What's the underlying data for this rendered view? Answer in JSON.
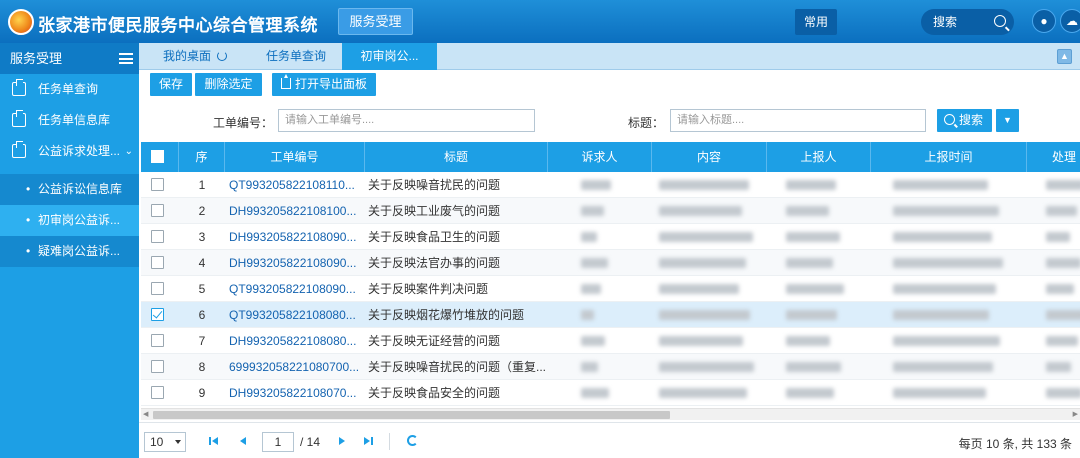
{
  "header": {
    "app_title": "张家港市便民服务中心综合管理系统",
    "top_tab": "服务受理",
    "fav_label": "常用",
    "search_placeholder": "搜索"
  },
  "sidebar": {
    "title": "服务受理",
    "items": [
      {
        "label": "任务单查询"
      },
      {
        "label": "任务单信息库"
      },
      {
        "label": "公益诉求处理..."
      }
    ],
    "subitems": [
      {
        "label": "公益诉讼信息库"
      },
      {
        "label": "初审岗公益诉..."
      },
      {
        "label": "疑难岗公益诉..."
      }
    ]
  },
  "tabs": [
    {
      "label": "我的桌面"
    },
    {
      "label": "任务单查询"
    },
    {
      "label": "初审岗公..."
    }
  ],
  "toolbar": {
    "save": "保存",
    "delete": "删除选定",
    "export": "打开导出面板"
  },
  "filter": {
    "order_label": "工单编号：",
    "order_placeholder": "请输入工单编号....",
    "title_label": "标题：",
    "title_placeholder": "请输入标题....",
    "search_label": "搜索"
  },
  "table": {
    "columns": [
      "序",
      "工单编号",
      "标题",
      "诉求人",
      "内容",
      "上报人",
      "上报时间",
      "处理"
    ],
    "rows": [
      {
        "no": "1",
        "id": "QT993205822108110...",
        "title": "关于反映噪音扰民的问题",
        "checked": false
      },
      {
        "no": "2",
        "id": "DH993205822108100...",
        "title": "关于反映工业废气的问题",
        "checked": false
      },
      {
        "no": "3",
        "id": "DH993205822108090...",
        "title": "关于反映食品卫生的问题",
        "checked": false
      },
      {
        "no": "4",
        "id": "DH993205822108090...",
        "title": "关于反映法官办事的问题",
        "checked": false
      },
      {
        "no": "5",
        "id": "QT993205822108090...",
        "title": "关于反映案件判决问题",
        "checked": false
      },
      {
        "no": "6",
        "id": "QT993205822108080...",
        "title": "关于反映烟花爆竹堆放的问题",
        "checked": true
      },
      {
        "no": "7",
        "id": "DH993205822108080...",
        "title": "关于反映无证经营的问题",
        "checked": false
      },
      {
        "no": "8",
        "id": "699932058221080700...",
        "title": "关于反映噪音扰民的问题（重复...",
        "checked": false
      },
      {
        "no": "9",
        "id": "DH993205822108070...",
        "title": "关于反映食品安全的问题",
        "checked": false
      }
    ]
  },
  "pager": {
    "page_size": "10",
    "current_page": "1",
    "total_pages": "/ 14",
    "info": "每页 10 条, 共 133 条"
  },
  "colors": {
    "header_blue": "#0b6fbf",
    "accent": "#1d9fe5",
    "link": "#1463b0"
  }
}
